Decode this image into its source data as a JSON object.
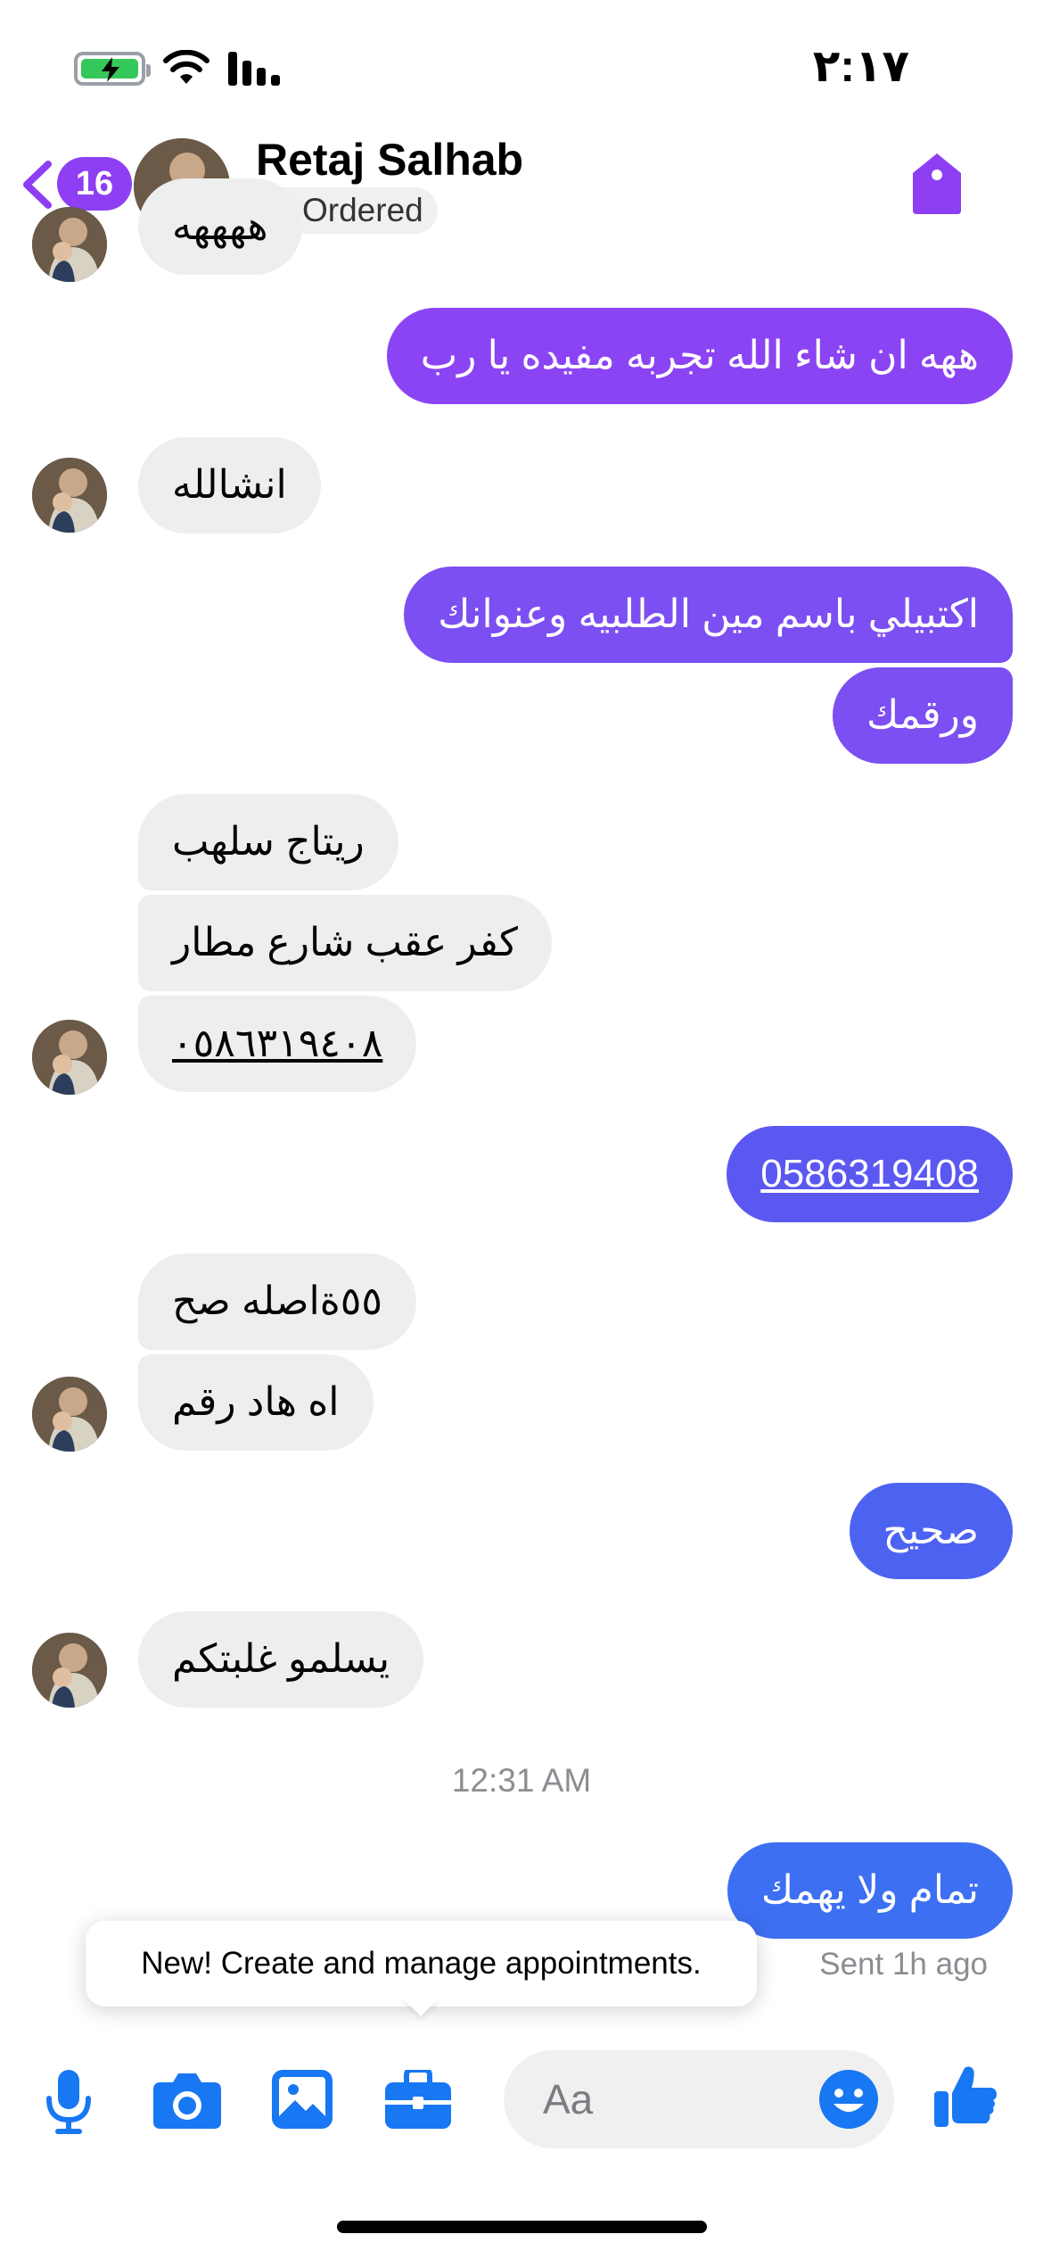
{
  "status_bar": {
    "time": "٢:١٧"
  },
  "header": {
    "back_badge": "16",
    "contact_name": "Retaj Salhab",
    "status_label": "Ordered",
    "colors": {
      "accent": "#8e3ff3",
      "status_dot": "#f5b92f"
    }
  },
  "messages": [
    {
      "side": "in",
      "text": "ههههه"
    },
    {
      "side": "out",
      "text": "ههه ان شاء الله تجربه مفيده يا رب"
    },
    {
      "side": "in",
      "text": "انشالله"
    },
    {
      "side": "out",
      "text": "اكتبيلي باسم مين الطلبيه وعنوانك"
    },
    {
      "side": "out",
      "text": "ورقمك"
    },
    {
      "side": "in",
      "text": "ريتاج سلهب"
    },
    {
      "side": "in",
      "text": "كفر عقب شارع مطار"
    },
    {
      "side": "in",
      "text": "٠٥٨٦٣١٩٤٠٨"
    },
    {
      "side": "out",
      "text": "0586319408"
    },
    {
      "side": "in",
      "text": "٥٥ةاصله صح"
    },
    {
      "side": "in",
      "text": "اه هاد رقم"
    },
    {
      "side": "out",
      "text": "صحيح"
    },
    {
      "side": "in",
      "text": "يسلمو غلبتكم"
    },
    {
      "side": "out",
      "text": "تمام ولا يهمك"
    }
  ],
  "timestamp": "12:31 AM",
  "sent_status": "Sent 1h ago",
  "tooltip": "New! Create and manage appointments.",
  "composer": {
    "placeholder": "Aa",
    "icons": [
      "microphone-icon",
      "camera-icon",
      "gallery-icon",
      "briefcase-icon",
      "emoji-icon",
      "thumbs-up-icon"
    ],
    "icon_color": "#1877f2"
  }
}
